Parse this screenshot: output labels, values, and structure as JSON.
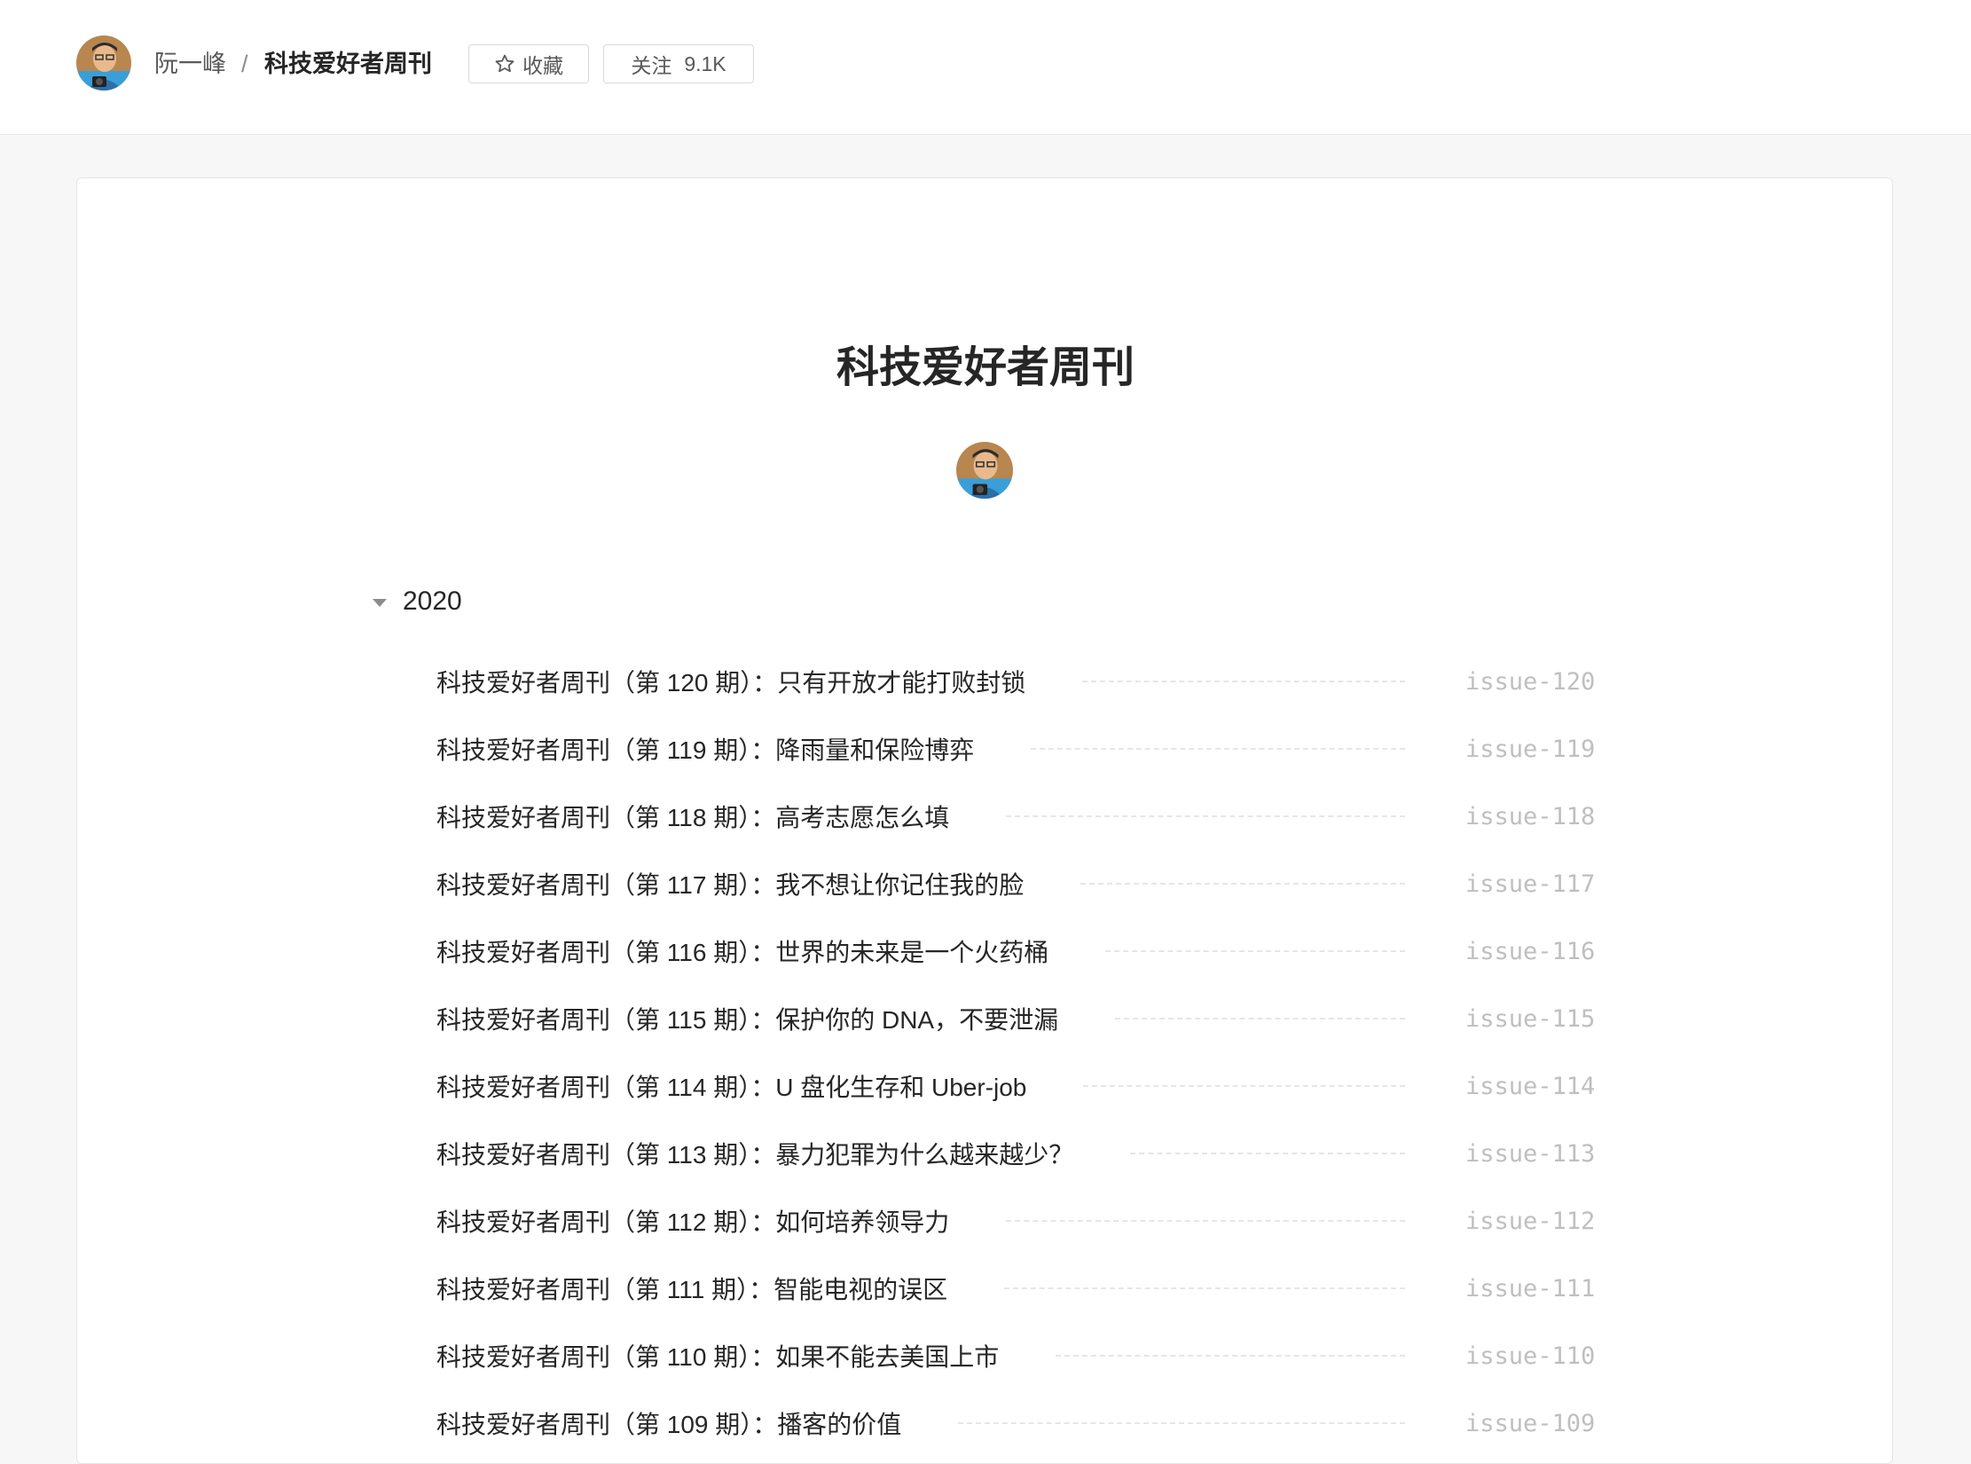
{
  "header": {
    "user_name": "阮一峰",
    "separator": "/",
    "book_name": "科技爱好者周刊",
    "favorite_label": "收藏",
    "follow_label": "关注",
    "follow_count": "9.1K"
  },
  "book": {
    "title": "科技爱好者周刊"
  },
  "toc": {
    "year": "2020",
    "items": [
      {
        "title": "科技爱好者周刊（第 120 期）：只有开放才能打败封锁",
        "slug": "issue-120"
      },
      {
        "title": "科技爱好者周刊（第 119 期）：降雨量和保险博弈",
        "slug": "issue-119"
      },
      {
        "title": "科技爱好者周刊（第 118 期）：高考志愿怎么填",
        "slug": "issue-118"
      },
      {
        "title": "科技爱好者周刊（第 117 期）：我不想让你记住我的脸",
        "slug": "issue-117"
      },
      {
        "title": "科技爱好者周刊（第 116 期）：世界的未来是一个火药桶",
        "slug": "issue-116"
      },
      {
        "title": "科技爱好者周刊（第 115 期）：保护你的 DNA，不要泄漏",
        "slug": "issue-115"
      },
      {
        "title": "科技爱好者周刊（第 114 期）：U 盘化生存和 Uber-job",
        "slug": "issue-114"
      },
      {
        "title": "科技爱好者周刊（第 113 期）：暴力犯罪为什么越来越少？",
        "slug": "issue-113"
      },
      {
        "title": "科技爱好者周刊（第 112 期）：如何培养领导力",
        "slug": "issue-112"
      },
      {
        "title": "科技爱好者周刊（第 111 期）：智能电视的误区",
        "slug": "issue-111"
      },
      {
        "title": "科技爱好者周刊（第 110 期）：如果不能去美国上市",
        "slug": "issue-110"
      },
      {
        "title": "科技爱好者周刊（第 109 期）：播客的价值",
        "slug": "issue-109"
      }
    ]
  }
}
